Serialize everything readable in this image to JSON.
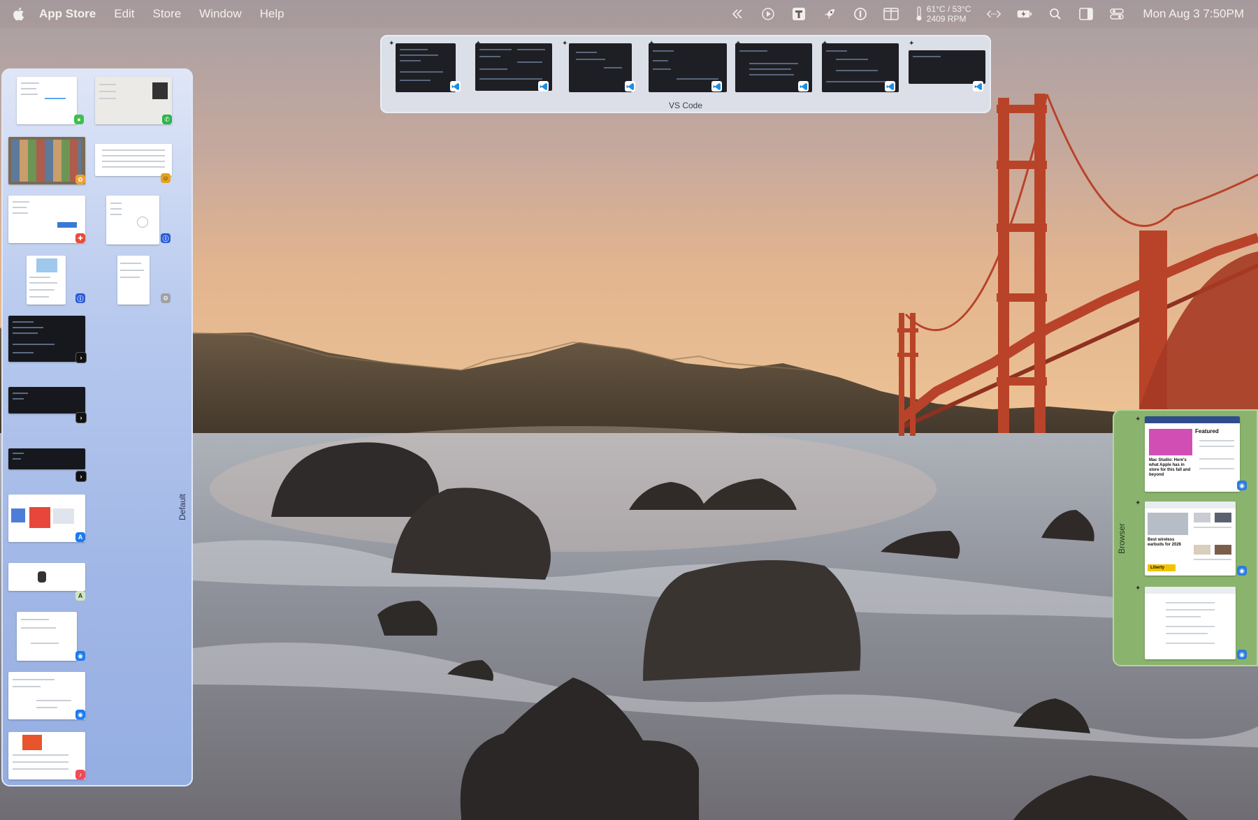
{
  "menubar": {
    "app_name": "App Store",
    "menus": [
      "Edit",
      "Store",
      "Window",
      "Help"
    ],
    "status_icons": [
      "chevrons-left-icon",
      "play-circle-icon",
      "t-app-icon",
      "rocket-icon",
      "password-manager-icon",
      "split-view-icon",
      "thermometer-icon",
      "code-arrows-icon",
      "battery-charging-icon",
      "search-icon",
      "sidebar-icon",
      "control-center-icon"
    ],
    "temp_line1": "61°C / 53°C",
    "temp_line2": "2409 RPM",
    "clock": "Mon Aug 3  7:50PM"
  },
  "groups": {
    "default_label": "Default",
    "vscode_label": "VS Code",
    "browser_label": "Browser"
  },
  "browser_thumbs": {
    "t1_heading": "Featured",
    "t1_title": "Mac Studio: Here's what Apple has in store for this fall and beyond",
    "t2_title": "Best wireless earbuds for 2026",
    "t2_brand": "Liberty"
  },
  "colors": {
    "default_group": "#a8bdea",
    "browser_group": "#8ab46e",
    "vscode_group": "#dee4ee",
    "vscode_badge": "#1f8fe0"
  }
}
